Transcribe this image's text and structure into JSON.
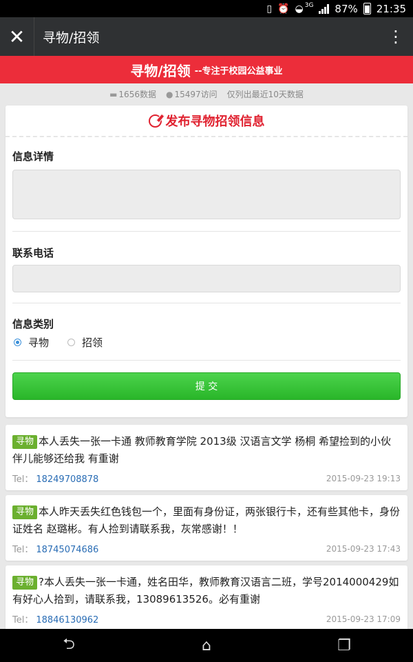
{
  "status_bar": {
    "network": "3G",
    "battery": "87%",
    "time": "21:35"
  },
  "app_bar": {
    "title": "寻物/招领"
  },
  "banner": {
    "title": "寻物/招领",
    "subtitle": "--专注于校园公益事业"
  },
  "stats": {
    "data_count": "1656数据",
    "visits": "15497访问",
    "note": "仅列出最近10天数据"
  },
  "form": {
    "header": "发布寻物招领信息",
    "detail_label": "信息详情",
    "detail_value": "",
    "phone_label": "联系电话",
    "phone_value": "",
    "type_label": "信息类别",
    "options": [
      "寻物",
      "招领"
    ],
    "selected_option": "寻物",
    "submit_label": "提 交"
  },
  "posts": [
    {
      "tag": "寻物",
      "text": "本人丢失一张一卡通 教师教育学院 2013级 汉语言文学 杨桐 希望捡到的小伙伴儿能够还给我 有重谢",
      "tel_label": "Tel：",
      "tel": "18249708878",
      "time": "2015-09-23 19:13"
    },
    {
      "tag": "寻物",
      "text": "本人昨天丢失红色钱包一个，里面有身份证，两张银行卡，还有些其他卡，身份证姓名 赵璐彬。有人捡到请联系我，灰常感谢！！",
      "tel_label": "Tel：",
      "tel": "18745074686",
      "time": "2015-09-23 17:43"
    },
    {
      "tag": "寻物",
      "text": "?本人丢失一张一卡通，姓名田华，教师教育汉语言二班，学号2014000429如有好心人拾到，请联系我，13089613526。必有重谢",
      "tel_label": "Tel：",
      "tel": "18846130962",
      "time": "2015-09-23 17:09"
    }
  ],
  "colors": {
    "banner_red": "#ec2d3a",
    "submit_green": "#3bc43b",
    "tag_green": "#6bb02f",
    "link_blue": "#2a6db5"
  }
}
